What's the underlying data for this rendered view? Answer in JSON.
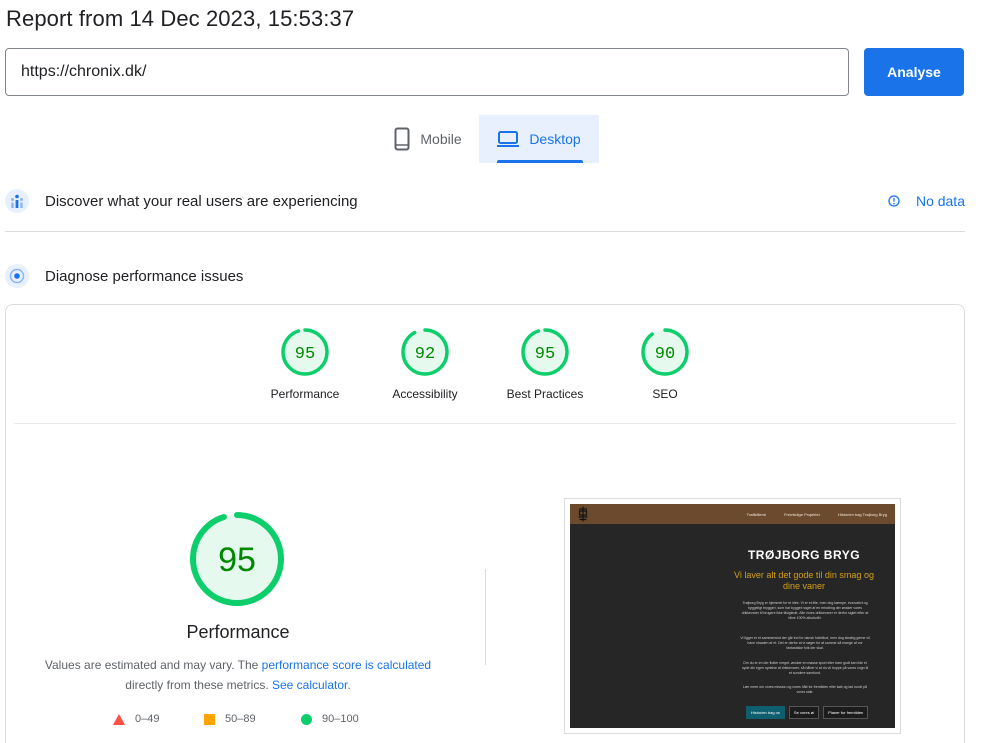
{
  "report_title": "Report from 14 Dec 2023, 15:53:37",
  "url_input": {
    "value": "https://chronix.dk/"
  },
  "analyse_label": "Analyse",
  "tabs": {
    "mobile": "Mobile",
    "desktop": "Desktop",
    "selected": "Desktop"
  },
  "real_users": {
    "title": "Discover what your real users are experiencing",
    "no_data": "No data"
  },
  "diagnose": {
    "title": "Diagnose performance issues"
  },
  "scores": [
    {
      "value": "95",
      "label": "Performance"
    },
    {
      "value": "92",
      "label": "Accessibility"
    },
    {
      "value": "95",
      "label": "Best Practices"
    },
    {
      "value": "90",
      "label": "SEO"
    }
  ],
  "performance": {
    "score": "95",
    "label": "Performance",
    "note_prefix": "Values are estimated and may vary. The ",
    "note_link": "performance score is calculated",
    "note_middle": "directly from these metrics. ",
    "note_link2": "See calculator",
    "note_suffix": "."
  },
  "legend": {
    "fail": "0–49",
    "average": "50–89",
    "pass": "90–100"
  },
  "colors": {
    "accent": "#1a73e8",
    "pass": "#0cce6b",
    "pass_text": "#008800",
    "pass_bg": "#e6f9ee",
    "average": "#ffa400",
    "fail": "#ff4e42"
  },
  "screenshot": {
    "nav": [
      "Trafikfilene",
      "Fremtidige Projekter",
      "Historien bag Trøjborg Bryg"
    ],
    "heading": "TRØJBORG BRYG",
    "subheading": "Vi laver alt det gode til din smag og dine vaner",
    "paragraphs": [
      "Trøjborg Bryg er hjemmet for et idée. Vi er et lille, men dog kæmpe, innovativt og hyggeligt bryggeri, som har bygget noget af en erindring der ønsker vores drikkevarer til brugere ikke tilsigtede. Alle vores drikkevarer er derfor sigtet efter at blive 100% alkoholfri.",
      "Vi ligger er et sammenslut der går ind for dansk hobbitud, men dog skrøbg gerne vil have straalen af et. Det er derfor at vi søger for at samme så mange af vor fantastiske folk der skal.",
      "Om du er en der flotter meget, ønsker en masse sport eller bare godt kan lide et nyde din egen nydelse af drikkevarer, så håber vi at du vil hoppe på vores vogn til et sundere samfund.",
      "Lær mere om vores mission og vores håb for fremtiden eller køb og lad rundt på vores side."
    ],
    "buttons": [
      "Historien bag os",
      "Se vores øl",
      "Planer for fremtiden"
    ]
  }
}
